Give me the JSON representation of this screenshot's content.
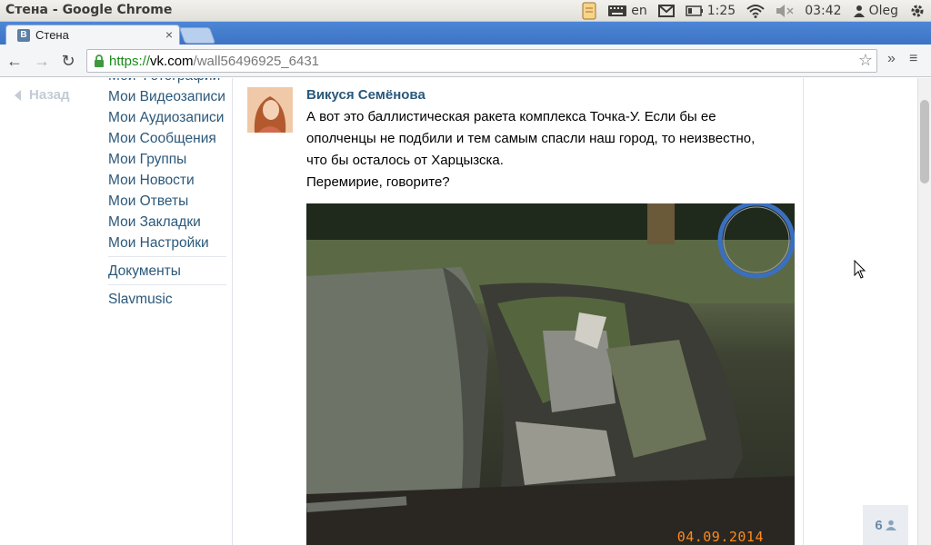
{
  "os_panel": {
    "window_title": "Стена - Google Chrome",
    "keyboard_layout": "en",
    "battery_time": "1:25",
    "clock": "03:42",
    "user": "Oleg",
    "icons": [
      "notes-icon",
      "keyboard-icon",
      "mail-icon",
      "battery-icon",
      "wifi-icon",
      "volume-muted-icon",
      "user-icon",
      "gear-icon"
    ]
  },
  "browser": {
    "tab": {
      "title": "Стена",
      "favicon": "В"
    },
    "url": {
      "scheme": "https://",
      "host": "vk.com",
      "path": "/wall56496925_6431"
    }
  },
  "sidebar": {
    "back_label": "Назад",
    "items": [
      {
        "label": "Мои Фотографии"
      },
      {
        "label": "Мои Видеозаписи"
      },
      {
        "label": "Мои Аудиозаписи"
      },
      {
        "label": "Мои Сообщения"
      },
      {
        "label": "Мои Группы"
      },
      {
        "label": "Мои Новости"
      },
      {
        "label": "Мои Ответы"
      },
      {
        "label": "Мои Закладки"
      },
      {
        "label": "Мои Настройки"
      }
    ],
    "extra": [
      {
        "label": "Документы"
      },
      {
        "label": "Slavmusic"
      }
    ]
  },
  "post": {
    "author": "Викуся Семёнова",
    "text_lines": [
      "А вот это баллистическая ракета комплекса Точка-У. Если бы ее",
      "ополченцы не подбили и тем самым спасли наш город, то неизвестно,",
      "что бы осталось от Харцызска.",
      "Перемирие, говорите?"
    ],
    "photo_date": "04.09.2014"
  },
  "counter": {
    "value": "6",
    "icon": "person-icon"
  },
  "colors": {
    "link": "#2b587a",
    "tabstrip": "#4d86d6",
    "date_stamp": "#ff8a1e"
  }
}
